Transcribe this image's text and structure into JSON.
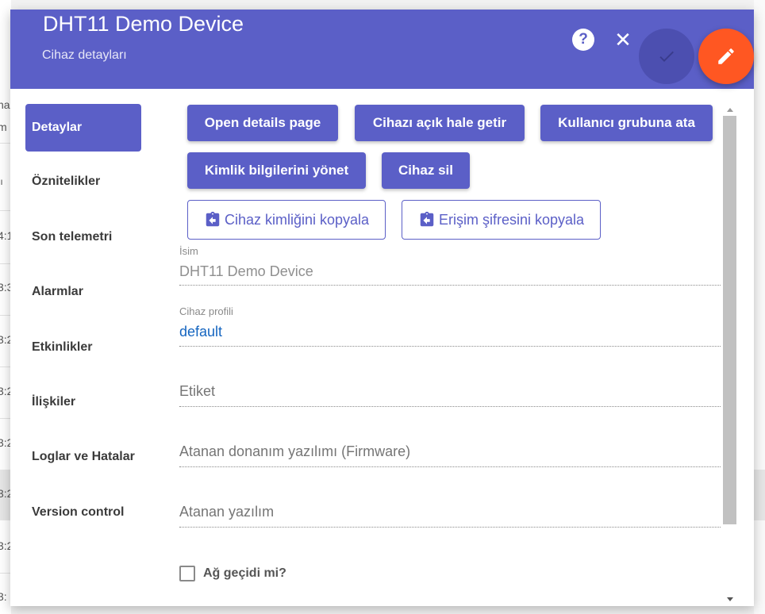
{
  "background": {
    "fragments": [
      "naz",
      "m",
      "ıı",
      "4:1",
      "3:3",
      "3:2",
      "3:2",
      "3:2",
      "3:2",
      "3:2",
      "3:"
    ]
  },
  "dialog": {
    "title": "DHT11 Demo Device",
    "subtitle": "Cihaz detayları",
    "help_icon": "?",
    "close_icon": "✕",
    "apply_icon": "check-icon",
    "edit_icon": "pencil-icon"
  },
  "tabs": [
    {
      "label": "Detaylar",
      "active": true
    },
    {
      "label": "Öznitelikler",
      "active": false
    },
    {
      "label": "Son telemetri",
      "active": false
    },
    {
      "label": "Alarmlar",
      "active": false
    },
    {
      "label": "Etkinlikler",
      "active": false
    },
    {
      "label": "İlişkiler",
      "active": false
    },
    {
      "label": "Loglar ve Hatalar",
      "active": false
    },
    {
      "label": "Version control",
      "active": false
    }
  ],
  "actions": {
    "open_details": "Open details page",
    "make_public": "Cihazı açık hale getir",
    "assign_group": "Kullanıcı grubuna ata",
    "manage_credentials": "Kimlik bilgilerini yönet",
    "delete_device": "Cihaz sil",
    "copy_device_id": "Cihaz kimliğini kopyala",
    "copy_access_token": "Erişim şifresini kopyala"
  },
  "form": {
    "name_label": "İsim",
    "name_value": "DHT11 Demo Device",
    "profile_label": "Cihaz profili",
    "profile_value": "default",
    "label_placeholder": "Etiket",
    "firmware_placeholder": "Atanan donanım yazılımı (Firmware)",
    "software_placeholder": "Atanan yazılım",
    "gateway_label": "Ağ geçidi mi?"
  },
  "colors": {
    "primary": "#5b5fc7",
    "accent": "#ff5722",
    "link": "#1565c0"
  }
}
